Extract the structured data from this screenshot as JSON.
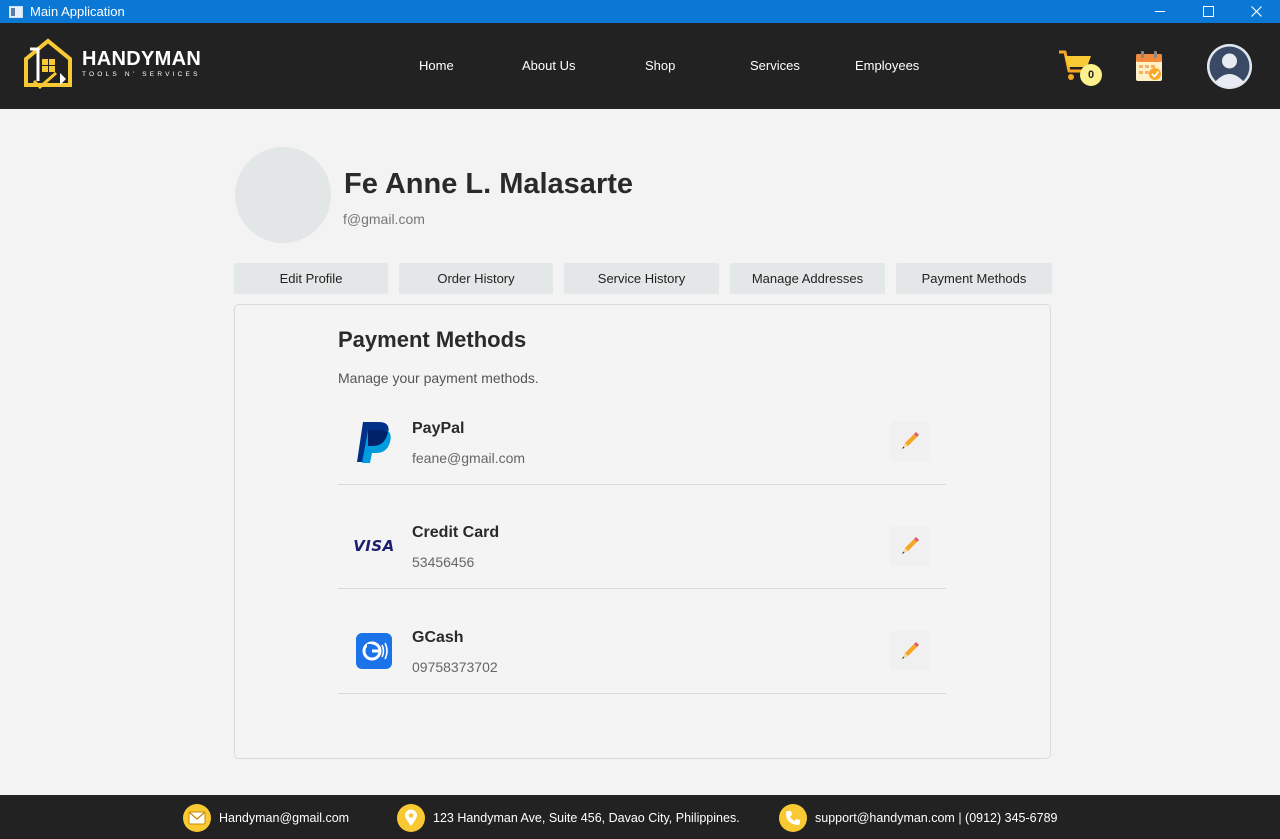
{
  "window": {
    "title": "Main Application"
  },
  "brand": {
    "name": "HANDYMAN",
    "tagline": "TOOLS N' SERVICES"
  },
  "nav": {
    "links": [
      "Home",
      "About Us",
      "Shop",
      "Services",
      "Employees"
    ],
    "cart_count": "0"
  },
  "profile": {
    "name": "Fe Anne L. Malasarte",
    "email": "f@gmail.com"
  },
  "tabs": [
    "Edit Profile",
    "Order History",
    "Service History",
    "Manage Addresses",
    "Payment Methods"
  ],
  "payment": {
    "title": "Payment Methods",
    "subtitle": "Manage your payment methods.",
    "methods": [
      {
        "name": "PayPal",
        "detail": "feane@gmail.com",
        "icon": "paypal-icon"
      },
      {
        "name": "Credit Card",
        "detail": "53456456",
        "icon": "visa-icon",
        "icon_text": "VISA"
      },
      {
        "name": "GCash",
        "detail": "09758373702",
        "icon": "gcash-icon"
      }
    ]
  },
  "footer": {
    "email": "Handyman@gmail.com",
    "address": "123 Handyman Ave, Suite 456, Davao City, Philippines.",
    "support": "support@handyman.com | (0912) 345-6789"
  },
  "colors": {
    "titlebar": "#0a78d4",
    "navbar": "#222222",
    "accent": "#f9c933",
    "panel": "#f4f4f4"
  }
}
